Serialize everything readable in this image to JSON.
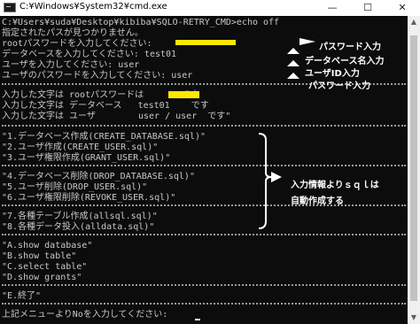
{
  "window": {
    "title": "C:¥Windows¥System32¥cmd.exe",
    "minimize": "—",
    "maximize": "☐",
    "close": "✕"
  },
  "console": {
    "lines": {
      "l0": "C:¥Users¥suda¥Desktop¥kibiba¥SQLO-RETRY_CMD>echo off",
      "l1": "指定されたパスが見つかりません。",
      "l2": "rootパスワードを入力してください:",
      "l3": "データベースを入力してください: test01",
      "l4": "ユーザを入力してください: user",
      "l5": "ユーザのパスワードを入力してください: user",
      "l6": "入力した文字は rootパスワードは       です",
      "l7": "入力した文字は データベース   test01    です",
      "l8": "入力した文字は ユーザ        user / user  です\"",
      "l9": "\"1.データベース作成(CREATE_DATABASE.sql)\"",
      "l10": "\"2.ユーザ作成(CREATE_USER.sql)\"",
      "l11": "\"3.ユーザ権限作成(GRANT_USER.sql)\"",
      "l12": "\"4.データベース削除(DROP_DATABASE.sql)\"",
      "l13": "\"5.ユーザ削除(DROP_USER.sql)\"",
      "l14": "\"6.ユーザ権限削除(REVOKE_USER.sql)\"",
      "l15": "\"7.各種テーブル作成(allsql.sql)\"",
      "l16": "\"8.各種データ投入(alldata.sql)\"",
      "l17": "\"A.show database\"",
      "l18": "\"B.show table\"",
      "l19": "\"C.select table\"",
      "l20": "\"D.show grants\"",
      "l21": "\"E.終了\"",
      "l22": "上記メニューよりNoを入力してください:"
    }
  },
  "annotations": {
    "root_password": "パスワード入力",
    "database_name": "データベース名入力",
    "user_id": "ユーザID入力",
    "user_password": "パスワード入力",
    "menu_note_1": "入力情報よりｓｑｌは",
    "menu_note_2": "自動作成する"
  },
  "colors": {
    "console_bg": "#0c0c0c",
    "console_text": "#c8c8c8",
    "highlight": "#ffe600",
    "annotation": "#ffffff"
  }
}
